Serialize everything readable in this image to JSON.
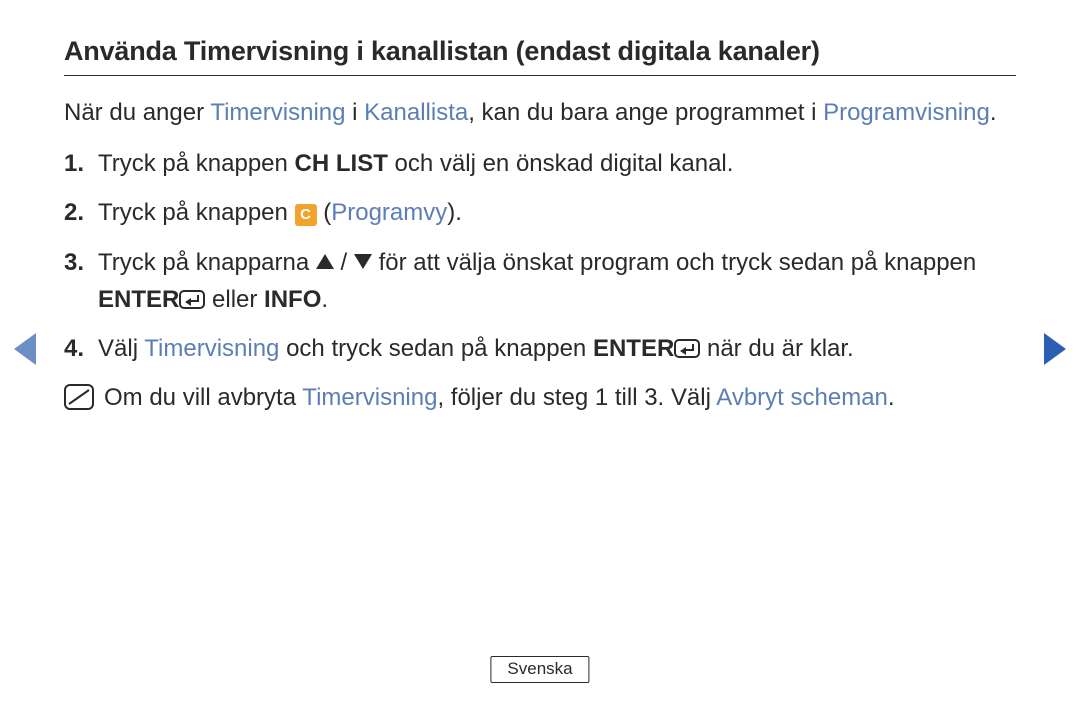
{
  "title": "Använda Timervisning i kanallistan (endast digitala kanaler)",
  "intro": {
    "p1a": "När du anger ",
    "term1": "Timervisning",
    "p1b": " i ",
    "term2": "Kanallista",
    "p1c": ", kan du bara ange programmet i ",
    "term3": "Programvisning",
    "p1d": "."
  },
  "steps": {
    "s1a": "Tryck på knappen ",
    "s1bold": "CH LIST",
    "s1b": " och välj en önskad digital kanal.",
    "s2a": "Tryck på knappen ",
    "s2badge": "C",
    "s2b": " (",
    "s2term": "Programvy",
    "s2c": ").",
    "s3a": "Tryck på knapparna ",
    "s3slash": " / ",
    "s3b": " för att välja önskat program och tryck sedan på knappen ",
    "s3enter": "ENTER",
    "s3c": " eller ",
    "s3info": "INFO",
    "s3d": ".",
    "s4a": "Välj ",
    "s4term": "Timervisning",
    "s4b": " och tryck sedan på knappen ",
    "s4enter": "ENTER",
    "s4c": " när du är klar."
  },
  "note": {
    "n1a": "Om du vill avbryta ",
    "n1term1": "Timervisning",
    "n1b": ", följer du steg 1 till 3. Välj ",
    "n1term2": "Avbryt scheman",
    "n1c": "."
  },
  "footer": {
    "lang": "Svenska"
  }
}
